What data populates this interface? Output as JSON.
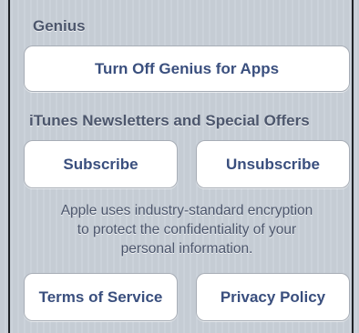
{
  "genius": {
    "header": "Genius",
    "turn_off_label": "Turn Off Genius for Apps"
  },
  "newsletters": {
    "header": "iTunes Newsletters and Special Offers",
    "subscribe_label": "Subscribe",
    "unsubscribe_label": "Unsubscribe"
  },
  "privacy_note": {
    "lines": [
      "Apple uses industry-standard encryption",
      "to protect the confidentiality of your",
      "personal information."
    ]
  },
  "footer": {
    "terms_label": "Terms of Service",
    "privacy_label": "Privacy Policy"
  }
}
